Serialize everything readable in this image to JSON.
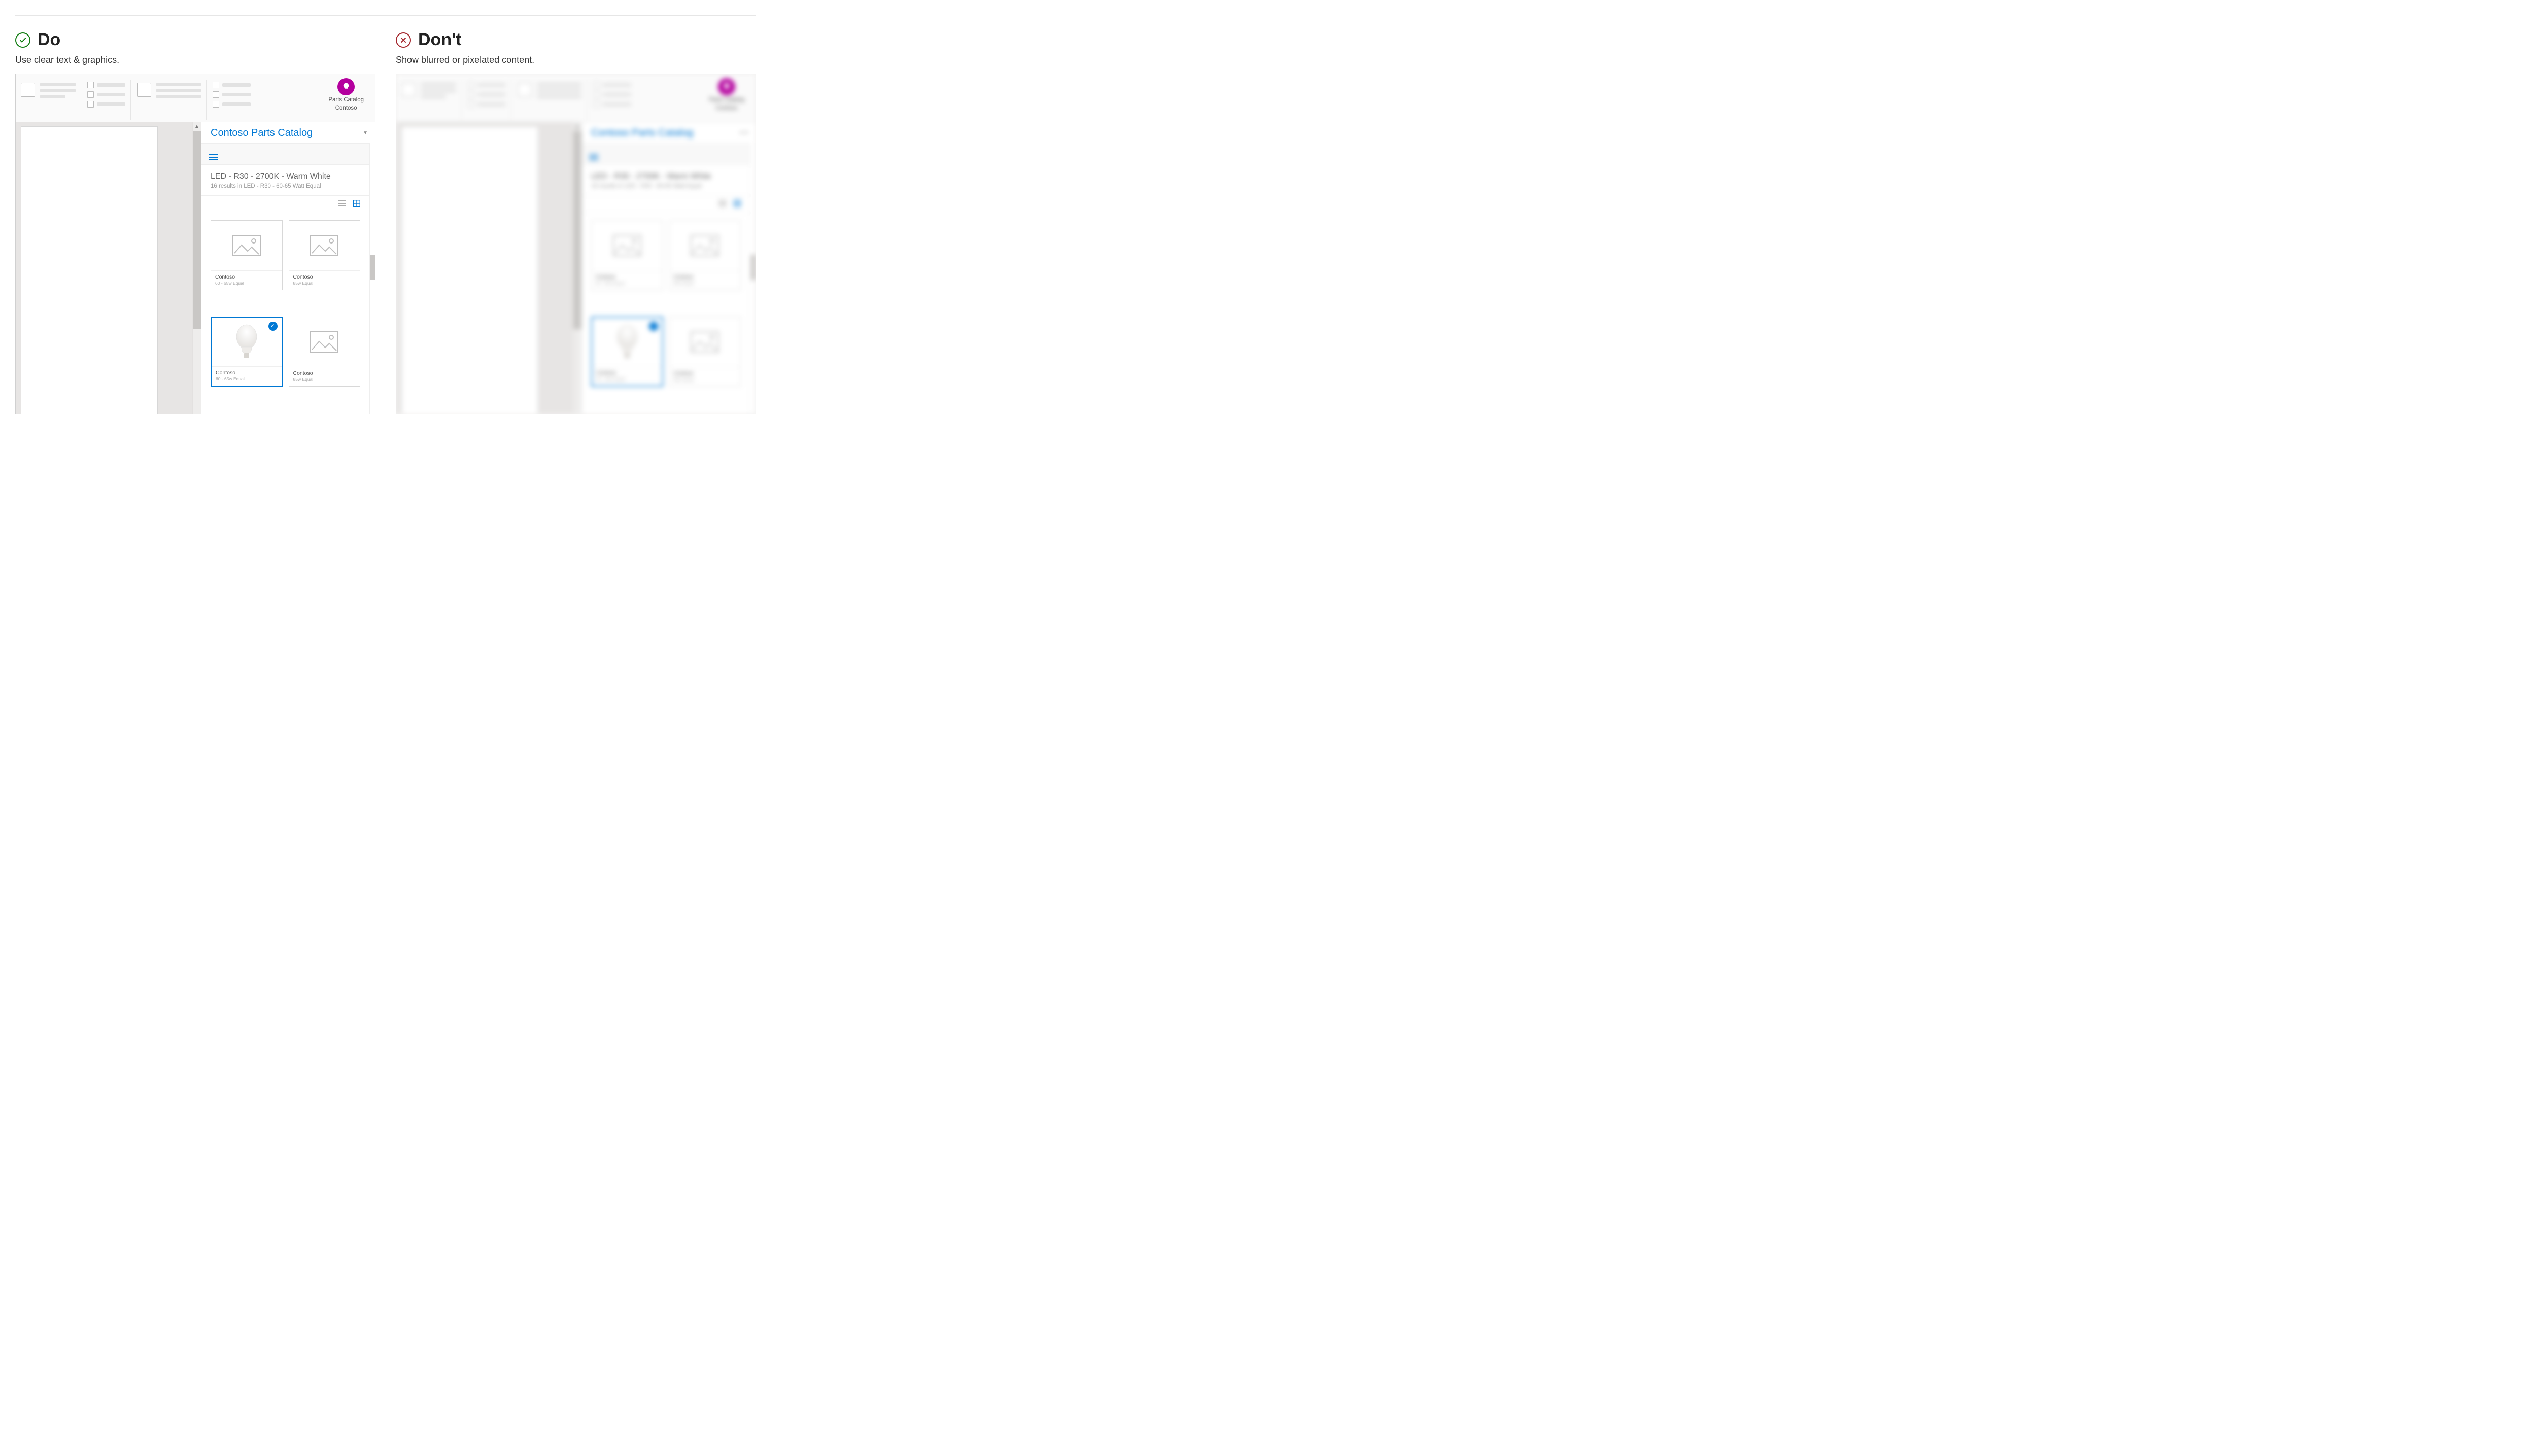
{
  "do": {
    "heading": "Do",
    "sub": "Use clear text & graphics."
  },
  "dont": {
    "heading": "Don't",
    "sub": "Show blurred or pixelated content."
  },
  "ribbon": {
    "addin_title": "Parts Catalog",
    "addin_company": "Contoso"
  },
  "pane": {
    "title": "Contoso Parts Catalog",
    "query": "LED - R30 - 2700K - Warm White",
    "results_line": "16 results in LED - R30 - 60-65 Watt Equal"
  },
  "cards": [
    {
      "brand": "Contoso",
      "spec": "60 - 65w Equal",
      "type": "placeholder",
      "selected": false
    },
    {
      "brand": "Contoso",
      "spec": "85w Equal",
      "type": "placeholder",
      "selected": false
    },
    {
      "brand": "Contoso",
      "spec": "60 - 65w Equal",
      "type": "bulb",
      "selected": true
    },
    {
      "brand": "Contoso",
      "spec": "85w Equal",
      "type": "placeholder",
      "selected": false
    }
  ]
}
